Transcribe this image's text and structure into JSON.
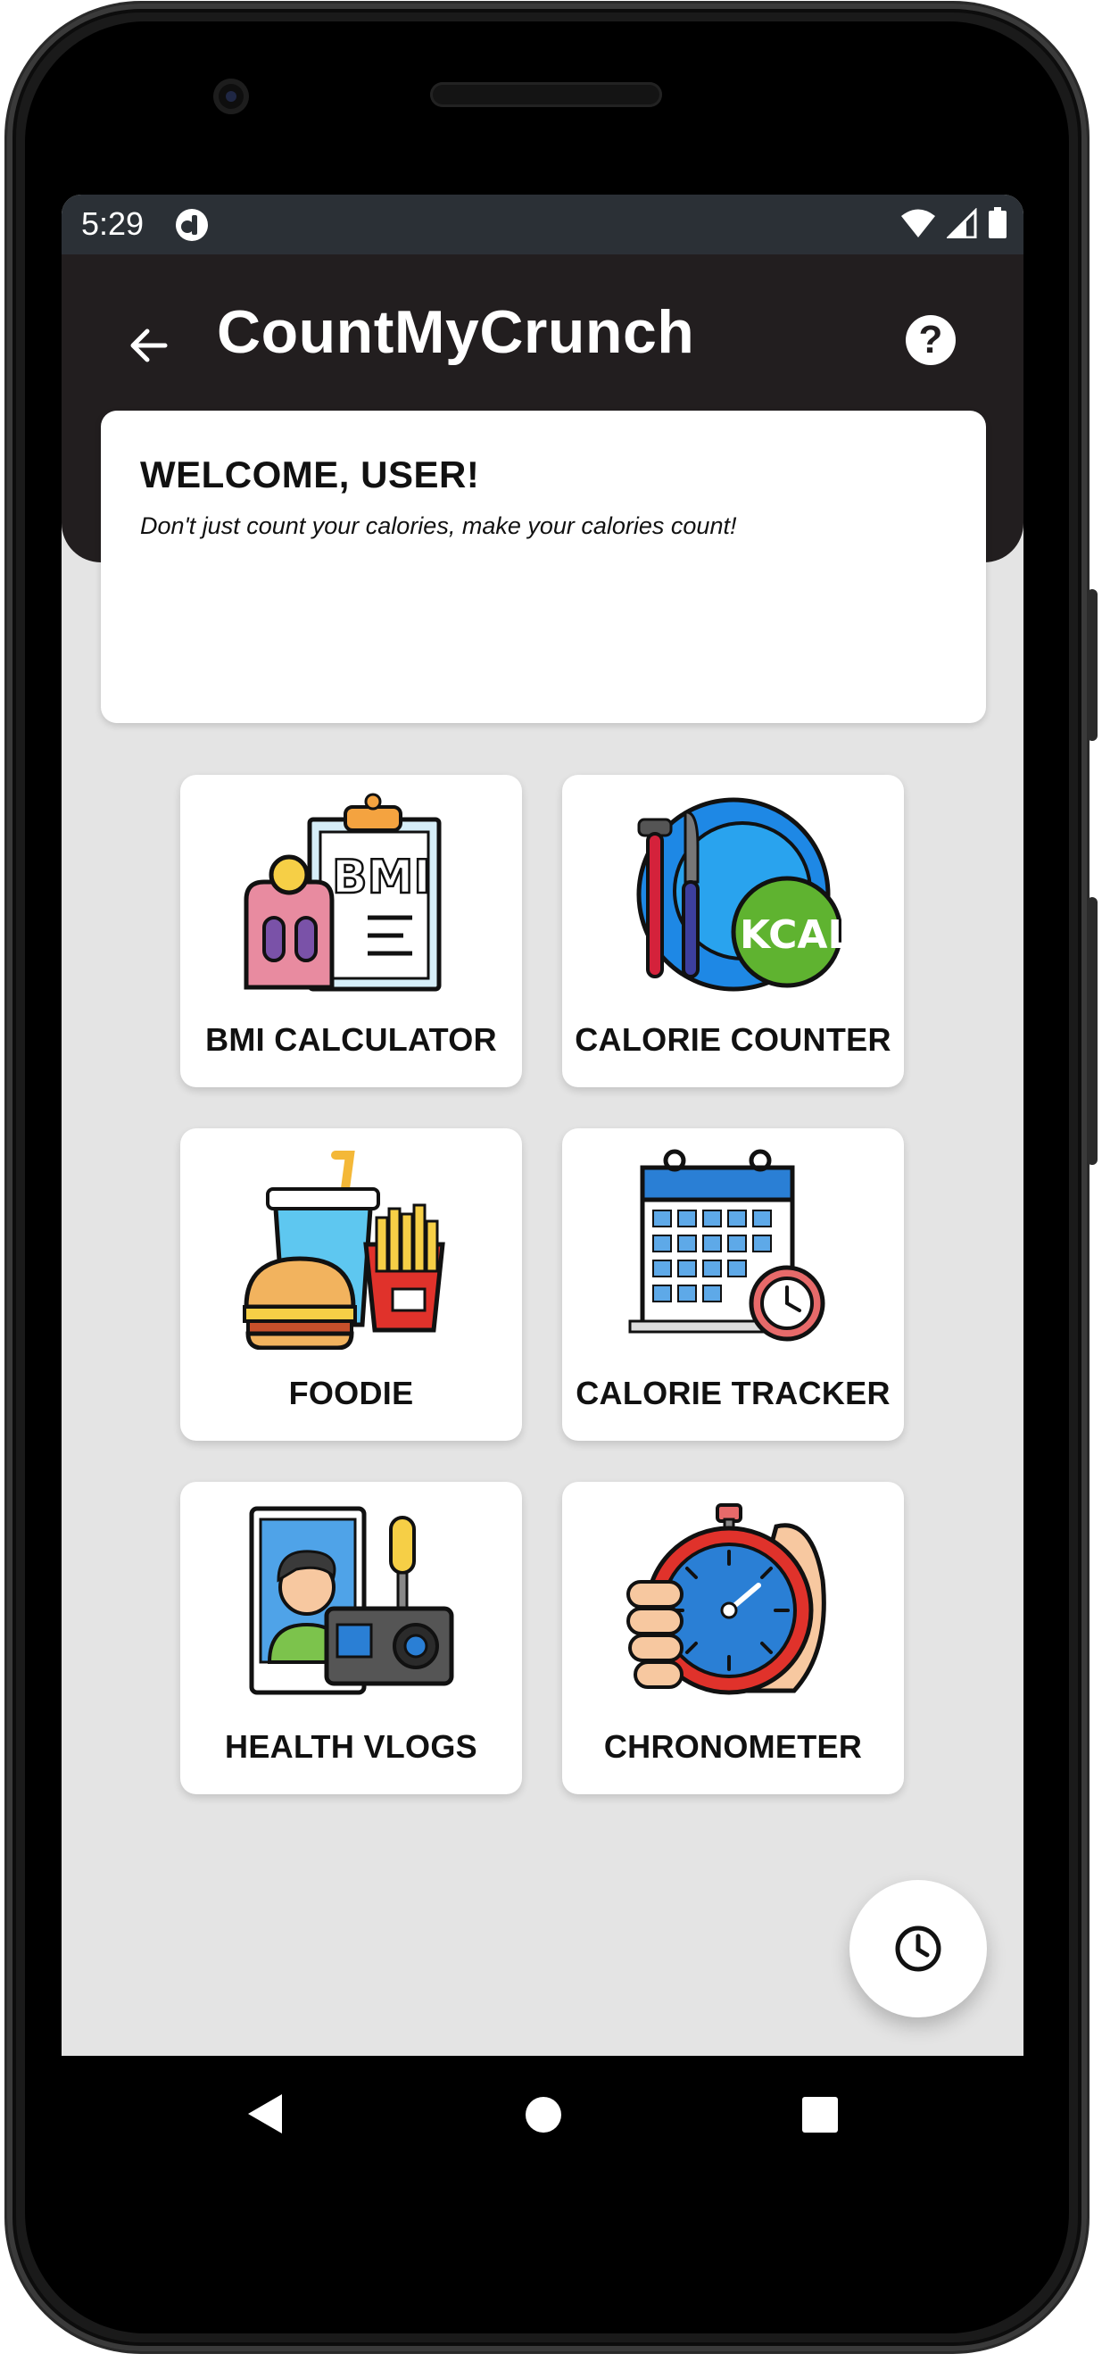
{
  "status_bar": {
    "time": "5:29"
  },
  "app_bar": {
    "title": "CountMyCrunch",
    "help_label": "?"
  },
  "welcome": {
    "title": "WELCOME, USER!",
    "subtitle": "Don't just count your calories, make your calories count!"
  },
  "tiles": [
    {
      "label": "BMI CALCULATOR",
      "icon": "bmi-clipboard-icon"
    },
    {
      "label": "CALORIE COUNTER",
      "icon": "kcal-plate-icon"
    },
    {
      "label": "FOODIE",
      "icon": "fast-food-icon"
    },
    {
      "label": "CALORIE TRACKER",
      "icon": "calendar-clock-icon"
    },
    {
      "label": "HEALTH VLOGS",
      "icon": "vlog-camera-icon"
    },
    {
      "label": "CHRONOMETER",
      "icon": "stopwatch-hand-icon"
    }
  ],
  "fab": {
    "icon": "clock-icon"
  },
  "icon_texts": {
    "bmi": "BMI",
    "kcal": "KCAL"
  },
  "colors": {
    "app_bar": "#221e1f",
    "status_bar": "#2b3036",
    "screen_bg": "#e4e4e4"
  }
}
